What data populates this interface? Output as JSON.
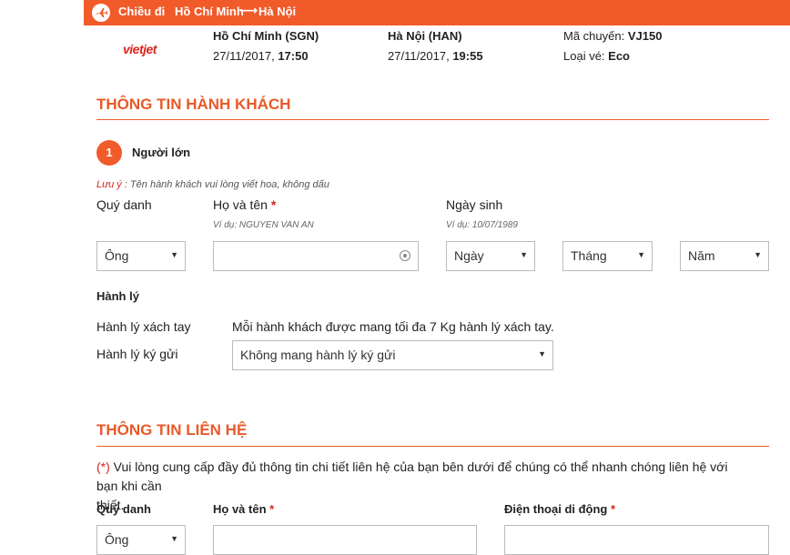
{
  "topbar": {
    "direction_label": "Chiều đi",
    "origin": "Hồ Chí Minh",
    "arrow": "⟶",
    "destination": "Hà Nội"
  },
  "flight": {
    "airline_logo": "vietjet",
    "departure_city": "Hồ Chí Minh (SGN)",
    "departure_date": "27/11/2017, ",
    "departure_time": "17:50",
    "arrival_city": "Hà Nội (HAN)",
    "arrival_date": "27/11/2017, ",
    "arrival_time": "19:55",
    "flight_no_label": "Mã chuyến: ",
    "flight_no": "VJ150",
    "fare_label": "Loại vé: ",
    "fare": "Eco"
  },
  "passenger_section": {
    "title": "THÔNG TIN HÀNH KHÁCH",
    "index": "1",
    "type": "Người lớn",
    "note_prefix": "Lưu ý",
    "note_text": " : Tên hành khách vui lòng viết hoa, không dấu",
    "title_label": "Quý danh",
    "name_label": "Họ và tên",
    "required_mark": "*",
    "name_hint": "Ví dụ: NGUYEN VAN AN",
    "dob_label": "Ngày sinh",
    "dob_hint": "Ví dụ: 10/07/1989",
    "title_value": "Ông",
    "name_value": "",
    "day_placeholder": "Ngày",
    "month_placeholder": "Tháng",
    "year_placeholder": "Năm",
    "baggage_title": "Hành lý",
    "carry_on_label": "Hành lý xách tay",
    "carry_on_text": "Mỗi hành khách được mang tối đa 7 Kg hành lý xách tay.",
    "checked_label": "Hành lý ký gửi",
    "checked_value": "Không mang hành lý ký gửi"
  },
  "contact_section": {
    "title": "THÔNG TIN LIÊN HỆ",
    "note_mark": "(*)",
    "note_text": " Vui lòng cung cấp đầy đủ thông tin chi tiết liên hệ của bạn bên dưới để chúng có thể nhanh chóng liên hệ với bạn khi cần",
    "note_text_2": "thiết.",
    "title_label": "Quý danh",
    "name_label": "Họ và tên",
    "phone_label": "Điện thoại di động",
    "required_mark": "*",
    "title_value": "Ông"
  },
  "colors": {
    "accent": "#f15a29",
    "required": "#d9261c"
  }
}
